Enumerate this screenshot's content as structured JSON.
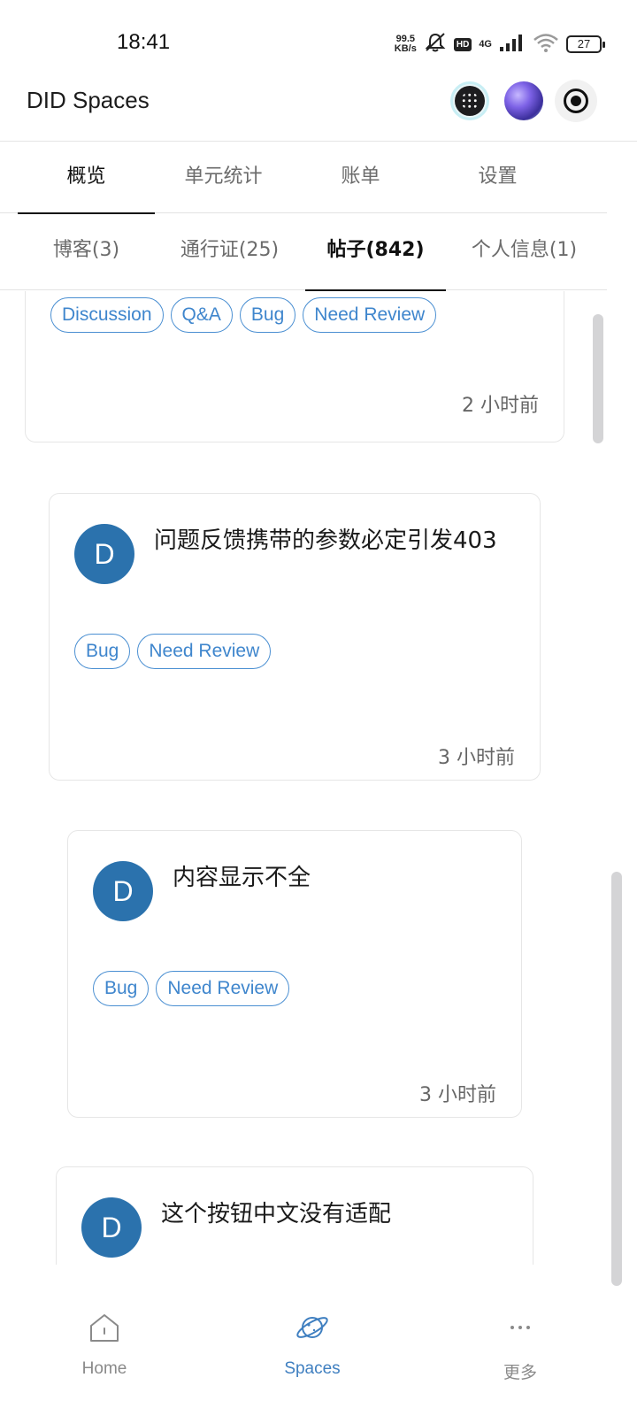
{
  "status_bar": {
    "time": "18:41",
    "net_speed_value": "99.5",
    "net_speed_unit": "KB/s",
    "hd": "HD",
    "network": "4G",
    "battery": "27"
  },
  "header": {
    "title": "DID Spaces"
  },
  "main_tabs": [
    {
      "label": "概览",
      "active": true
    },
    {
      "label": "单元统计",
      "active": false
    },
    {
      "label": "账单",
      "active": false
    },
    {
      "label": "设置",
      "active": false
    }
  ],
  "sub_tabs": [
    {
      "label": "博客(3)",
      "active": false
    },
    {
      "label": "通行证(25)",
      "active": false
    },
    {
      "label": "帖子(842)",
      "active": true
    },
    {
      "label": "个人信息(1)",
      "active": false
    }
  ],
  "posts": [
    {
      "tags": [
        "Discussion",
        "Q&A",
        "Bug",
        "Need Review"
      ],
      "time": "2 小时前"
    },
    {
      "avatar": "D",
      "title": "问题反馈携带的参数必定引发403",
      "tags": [
        "Bug",
        "Need Review"
      ],
      "time": "3 小时前"
    },
    {
      "avatar": "D",
      "title": "内容显示不全",
      "tags": [
        "Bug",
        "Need Review"
      ],
      "time": "3 小时前"
    },
    {
      "avatar": "D",
      "title": "这个按钮中文没有适配"
    }
  ],
  "bottom_nav": [
    {
      "label": "Home",
      "icon": "home-icon",
      "active": false
    },
    {
      "label": "Spaces",
      "icon": "planet-icon",
      "active": true
    },
    {
      "label": "更多",
      "icon": "more-icon",
      "active": false
    }
  ],
  "colors": {
    "accent": "#3f86cd",
    "avatar_bg": "#2b72ad"
  }
}
